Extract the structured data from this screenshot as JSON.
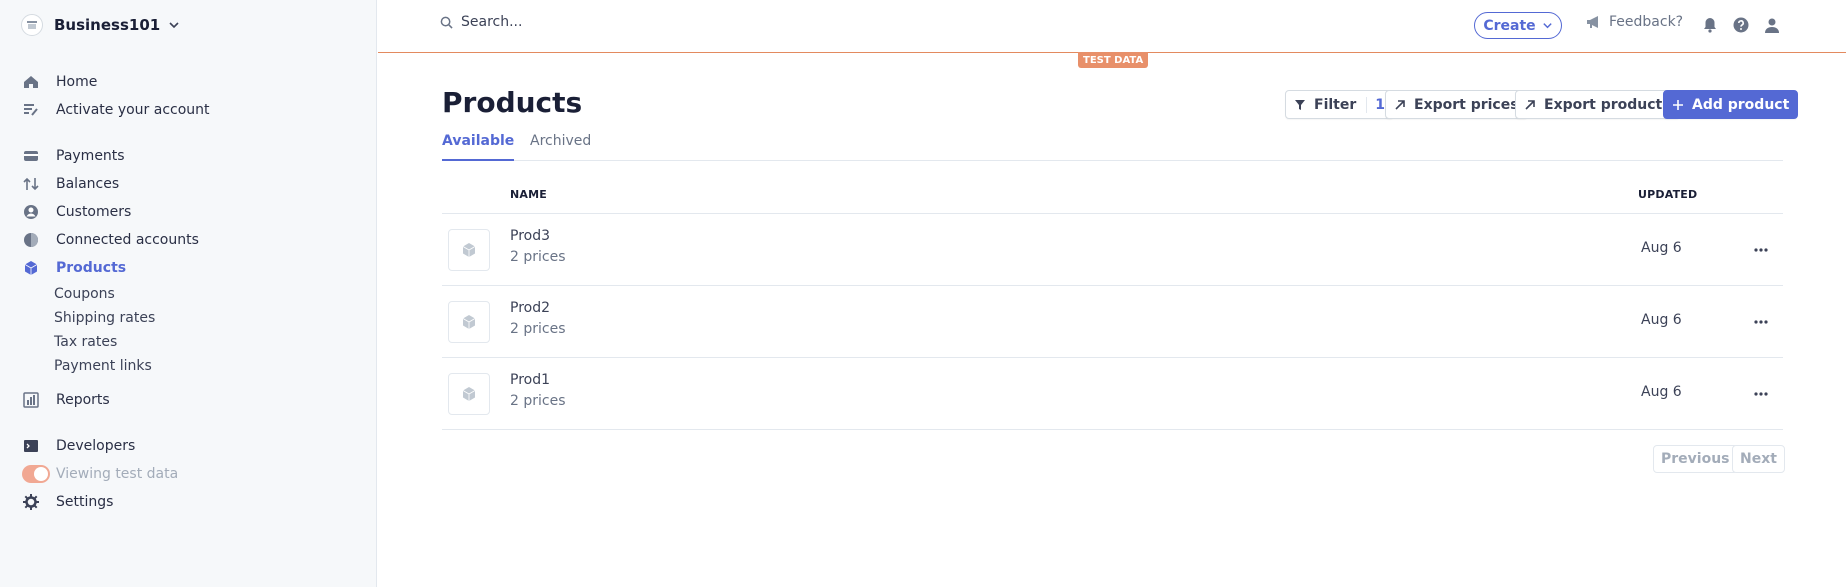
{
  "account": {
    "name": "Business101"
  },
  "nav": {
    "home": "Home",
    "activate": "Activate your account",
    "payments": "Payments",
    "balances": "Balances",
    "customers": "Customers",
    "connected": "Connected accounts",
    "products": "Products",
    "coupons": "Coupons",
    "shipping": "Shipping rates",
    "tax": "Tax rates",
    "payment_links": "Payment links",
    "reports": "Reports",
    "developers": "Developers",
    "test_toggle": "Viewing test data",
    "settings": "Settings"
  },
  "topbar": {
    "search_placeholder": "Search...",
    "create": "Create",
    "feedback": "Feedback?",
    "test_badge": "TEST DATA"
  },
  "page": {
    "title": "Products",
    "filter": "Filter",
    "filter_count": "1",
    "export_prices": "Export prices",
    "export_products": "Export products",
    "add_product": "Add product",
    "tabs": [
      "Available",
      "Archived"
    ]
  },
  "table": {
    "columns": {
      "name": "NAME",
      "updated": "UPDATED"
    },
    "rows": [
      {
        "name": "Prod3",
        "prices": "2 prices",
        "updated": "Aug 6"
      },
      {
        "name": "Prod2",
        "prices": "2 prices",
        "updated": "Aug 6"
      },
      {
        "name": "Prod1",
        "prices": "2 prices",
        "updated": "Aug 6"
      }
    ]
  },
  "pagination": {
    "previous": "Previous",
    "next": "Next"
  },
  "colors": {
    "accent": "#5469d4",
    "test_mode": "#e8906a",
    "sidebar_bg": "#f6f8fa"
  }
}
